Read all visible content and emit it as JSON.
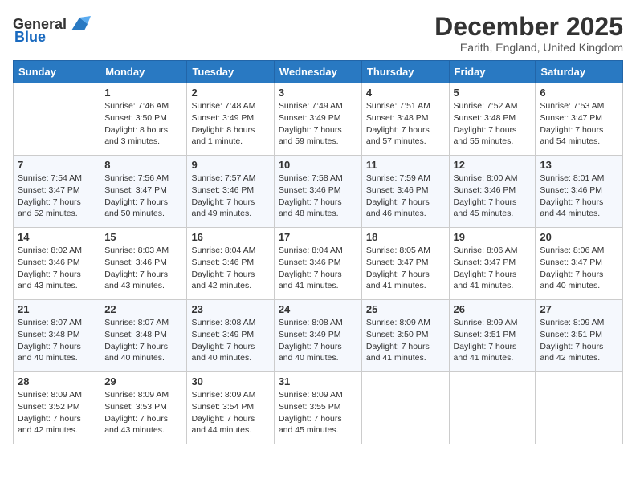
{
  "header": {
    "logo_general": "General",
    "logo_blue": "Blue",
    "month": "December 2025",
    "location": "Earith, England, United Kingdom"
  },
  "days_of_week": [
    "Sunday",
    "Monday",
    "Tuesday",
    "Wednesday",
    "Thursday",
    "Friday",
    "Saturday"
  ],
  "weeks": [
    [
      {
        "day": "",
        "sunrise": "",
        "sunset": "",
        "daylight": ""
      },
      {
        "day": "1",
        "sunrise": "Sunrise: 7:46 AM",
        "sunset": "Sunset: 3:50 PM",
        "daylight": "Daylight: 8 hours and 3 minutes."
      },
      {
        "day": "2",
        "sunrise": "Sunrise: 7:48 AM",
        "sunset": "Sunset: 3:49 PM",
        "daylight": "Daylight: 8 hours and 1 minute."
      },
      {
        "day": "3",
        "sunrise": "Sunrise: 7:49 AM",
        "sunset": "Sunset: 3:49 PM",
        "daylight": "Daylight: 7 hours and 59 minutes."
      },
      {
        "day": "4",
        "sunrise": "Sunrise: 7:51 AM",
        "sunset": "Sunset: 3:48 PM",
        "daylight": "Daylight: 7 hours and 57 minutes."
      },
      {
        "day": "5",
        "sunrise": "Sunrise: 7:52 AM",
        "sunset": "Sunset: 3:48 PM",
        "daylight": "Daylight: 7 hours and 55 minutes."
      },
      {
        "day": "6",
        "sunrise": "Sunrise: 7:53 AM",
        "sunset": "Sunset: 3:47 PM",
        "daylight": "Daylight: 7 hours and 54 minutes."
      }
    ],
    [
      {
        "day": "7",
        "sunrise": "Sunrise: 7:54 AM",
        "sunset": "Sunset: 3:47 PM",
        "daylight": "Daylight: 7 hours and 52 minutes."
      },
      {
        "day": "8",
        "sunrise": "Sunrise: 7:56 AM",
        "sunset": "Sunset: 3:47 PM",
        "daylight": "Daylight: 7 hours and 50 minutes."
      },
      {
        "day": "9",
        "sunrise": "Sunrise: 7:57 AM",
        "sunset": "Sunset: 3:46 PM",
        "daylight": "Daylight: 7 hours and 49 minutes."
      },
      {
        "day": "10",
        "sunrise": "Sunrise: 7:58 AM",
        "sunset": "Sunset: 3:46 PM",
        "daylight": "Daylight: 7 hours and 48 minutes."
      },
      {
        "day": "11",
        "sunrise": "Sunrise: 7:59 AM",
        "sunset": "Sunset: 3:46 PM",
        "daylight": "Daylight: 7 hours and 46 minutes."
      },
      {
        "day": "12",
        "sunrise": "Sunrise: 8:00 AM",
        "sunset": "Sunset: 3:46 PM",
        "daylight": "Daylight: 7 hours and 45 minutes."
      },
      {
        "day": "13",
        "sunrise": "Sunrise: 8:01 AM",
        "sunset": "Sunset: 3:46 PM",
        "daylight": "Daylight: 7 hours and 44 minutes."
      }
    ],
    [
      {
        "day": "14",
        "sunrise": "Sunrise: 8:02 AM",
        "sunset": "Sunset: 3:46 PM",
        "daylight": "Daylight: 7 hours and 43 minutes."
      },
      {
        "day": "15",
        "sunrise": "Sunrise: 8:03 AM",
        "sunset": "Sunset: 3:46 PM",
        "daylight": "Daylight: 7 hours and 43 minutes."
      },
      {
        "day": "16",
        "sunrise": "Sunrise: 8:04 AM",
        "sunset": "Sunset: 3:46 PM",
        "daylight": "Daylight: 7 hours and 42 minutes."
      },
      {
        "day": "17",
        "sunrise": "Sunrise: 8:04 AM",
        "sunset": "Sunset: 3:46 PM",
        "daylight": "Daylight: 7 hours and 41 minutes."
      },
      {
        "day": "18",
        "sunrise": "Sunrise: 8:05 AM",
        "sunset": "Sunset: 3:47 PM",
        "daylight": "Daylight: 7 hours and 41 minutes."
      },
      {
        "day": "19",
        "sunrise": "Sunrise: 8:06 AM",
        "sunset": "Sunset: 3:47 PM",
        "daylight": "Daylight: 7 hours and 41 minutes."
      },
      {
        "day": "20",
        "sunrise": "Sunrise: 8:06 AM",
        "sunset": "Sunset: 3:47 PM",
        "daylight": "Daylight: 7 hours and 40 minutes."
      }
    ],
    [
      {
        "day": "21",
        "sunrise": "Sunrise: 8:07 AM",
        "sunset": "Sunset: 3:48 PM",
        "daylight": "Daylight: 7 hours and 40 minutes."
      },
      {
        "day": "22",
        "sunrise": "Sunrise: 8:07 AM",
        "sunset": "Sunset: 3:48 PM",
        "daylight": "Daylight: 7 hours and 40 minutes."
      },
      {
        "day": "23",
        "sunrise": "Sunrise: 8:08 AM",
        "sunset": "Sunset: 3:49 PM",
        "daylight": "Daylight: 7 hours and 40 minutes."
      },
      {
        "day": "24",
        "sunrise": "Sunrise: 8:08 AM",
        "sunset": "Sunset: 3:49 PM",
        "daylight": "Daylight: 7 hours and 40 minutes."
      },
      {
        "day": "25",
        "sunrise": "Sunrise: 8:09 AM",
        "sunset": "Sunset: 3:50 PM",
        "daylight": "Daylight: 7 hours and 41 minutes."
      },
      {
        "day": "26",
        "sunrise": "Sunrise: 8:09 AM",
        "sunset": "Sunset: 3:51 PM",
        "daylight": "Daylight: 7 hours and 41 minutes."
      },
      {
        "day": "27",
        "sunrise": "Sunrise: 8:09 AM",
        "sunset": "Sunset: 3:51 PM",
        "daylight": "Daylight: 7 hours and 42 minutes."
      }
    ],
    [
      {
        "day": "28",
        "sunrise": "Sunrise: 8:09 AM",
        "sunset": "Sunset: 3:52 PM",
        "daylight": "Daylight: 7 hours and 42 minutes."
      },
      {
        "day": "29",
        "sunrise": "Sunrise: 8:09 AM",
        "sunset": "Sunset: 3:53 PM",
        "daylight": "Daylight: 7 hours and 43 minutes."
      },
      {
        "day": "30",
        "sunrise": "Sunrise: 8:09 AM",
        "sunset": "Sunset: 3:54 PM",
        "daylight": "Daylight: 7 hours and 44 minutes."
      },
      {
        "day": "31",
        "sunrise": "Sunrise: 8:09 AM",
        "sunset": "Sunset: 3:55 PM",
        "daylight": "Daylight: 7 hours and 45 minutes."
      },
      {
        "day": "",
        "sunrise": "",
        "sunset": "",
        "daylight": ""
      },
      {
        "day": "",
        "sunrise": "",
        "sunset": "",
        "daylight": ""
      },
      {
        "day": "",
        "sunrise": "",
        "sunset": "",
        "daylight": ""
      }
    ]
  ]
}
